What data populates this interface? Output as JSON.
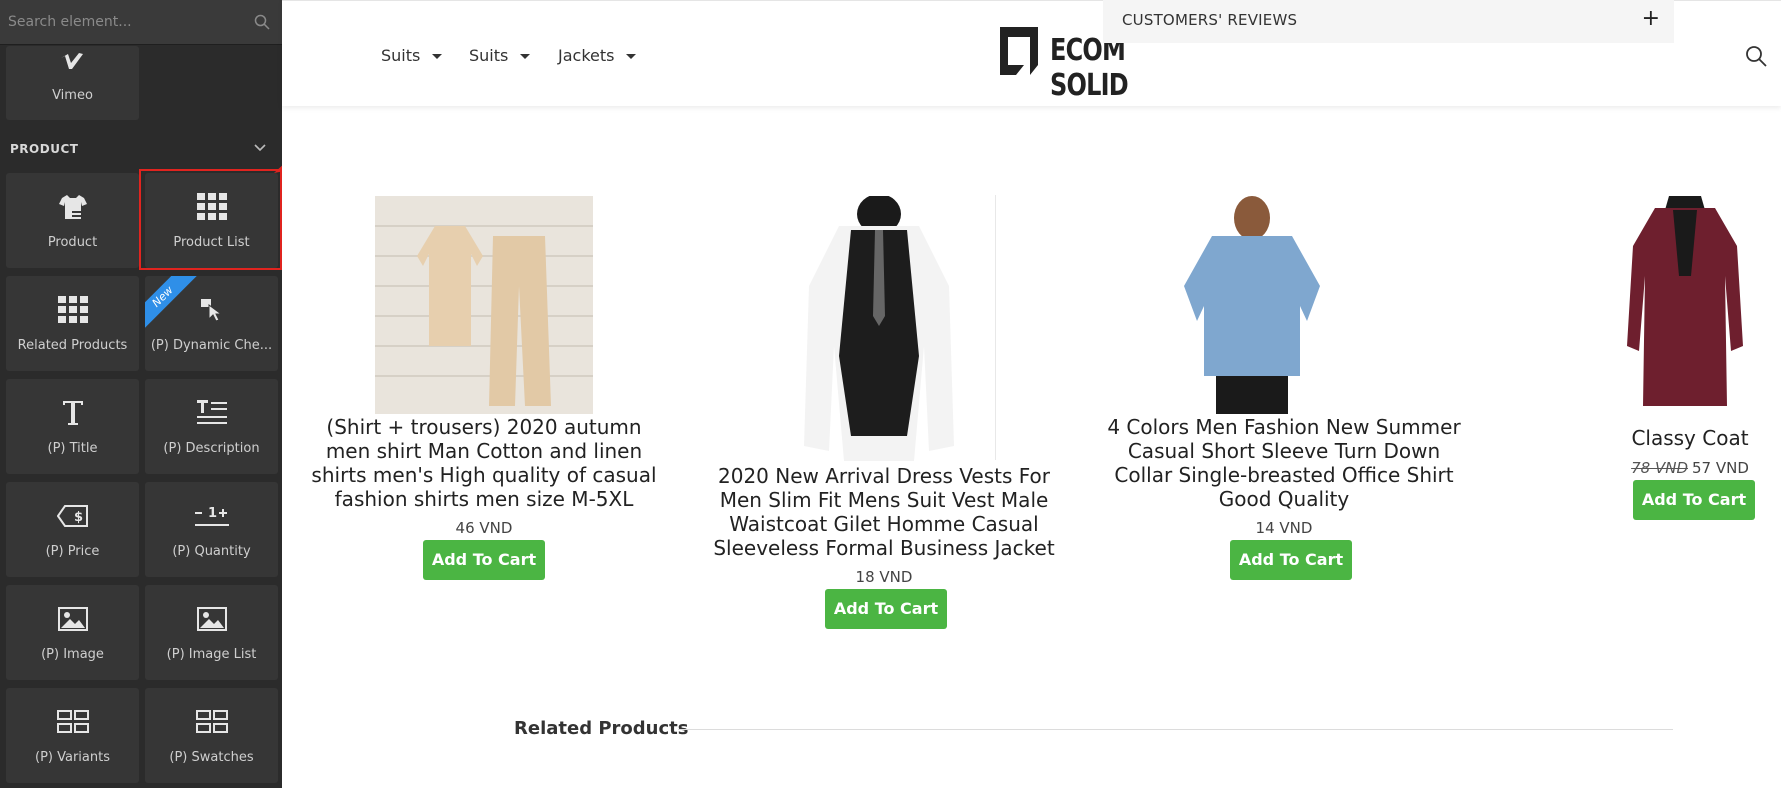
{
  "sidebar": {
    "search_placeholder": "Search element...",
    "vimeo_label": "Vimeo",
    "section_title": "PRODUCT",
    "tiles": [
      {
        "label": "Product",
        "icon": "shirt-icon"
      },
      {
        "label": "Product List",
        "icon": "grid-icon"
      },
      {
        "label": "Related Products",
        "icon": "grid-icon"
      },
      {
        "label": "(P) Dynamic Che...",
        "icon": "pointer-icon"
      },
      {
        "label": "(P) Title",
        "icon": "title-icon"
      },
      {
        "label": "(P) Description",
        "icon": "description-icon"
      },
      {
        "label": "(P) Price",
        "icon": "price-tag-icon"
      },
      {
        "label": "(P) Quantity",
        "icon": "quantity-icon"
      },
      {
        "label": "(P) Image",
        "icon": "image-icon"
      },
      {
        "label": "(P) Image List",
        "icon": "image-icon"
      },
      {
        "label": "(P) Variants",
        "icon": "variants-icon"
      },
      {
        "label": "(P) Swatches",
        "icon": "variants-icon"
      }
    ],
    "new_badge": "New"
  },
  "header": {
    "nav": [
      "Suits",
      "Suits",
      "Jackets"
    ],
    "logo_text": "ECOM SOLID",
    "reviews_label": "CUSTOMERS' REVIEWS",
    "reviews_toggle": "+"
  },
  "products": [
    {
      "title": "(Shirt + trousers) 2020 autumn men shirt Man Cotton and linen shirts men's High quality of casual fashion shirts men size M-5XL",
      "price": "46 VND",
      "button": "Add To Cart"
    },
    {
      "title": "2020 New Arrival Dress Vests For Men Slim Fit Mens Suit Vest Male Waistcoat Gilet Homme Casual Sleeveless Formal Business Jacket",
      "price": "18 VND",
      "button": "Add To Cart"
    },
    {
      "title": "4 Colors Men Fashion New Summer Casual Short Sleeve Turn Down Collar Single-breasted Office Shirt Good Quality",
      "price": "14 VND",
      "button": "Add To Cart"
    },
    {
      "title": "Classy Coat",
      "old_price": "78 VND",
      "price": "57 VND",
      "button": "Add To Cart"
    }
  ],
  "related_title": "Related Products",
  "colors": {
    "accent_green": "#4bb543",
    "highlight_red": "#e0241f",
    "sidebar_bg": "#2b2b2b",
    "badge_blue": "#2f8fe8"
  }
}
